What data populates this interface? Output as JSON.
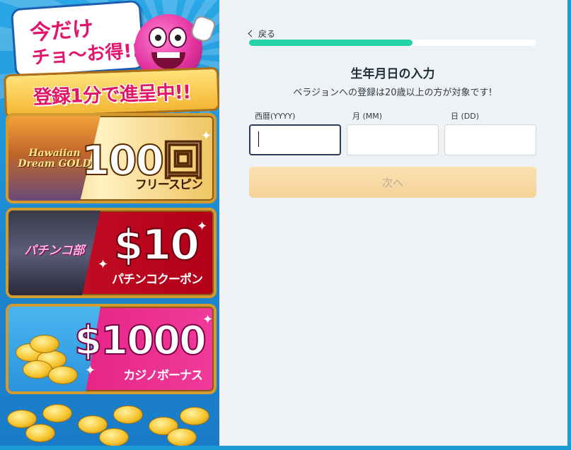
{
  "promo": {
    "bubble_line1": "今だけ",
    "bubble_line2": "チョ〜お得!!",
    "registration_banner": "登録1分で進呈中!!",
    "offers": [
      {
        "game": "Hawaiian Dream GOLD",
        "headline": "100回",
        "sub": "フリースピン"
      },
      {
        "game": "パチンコ部",
        "headline": "$10",
        "sub": "パチンコクーポン"
      },
      {
        "game": "",
        "headline": "$1000",
        "sub": "カジノボーナス"
      }
    ]
  },
  "form": {
    "back_label": "戻る",
    "progress": 0.57,
    "title": "生年月日の入力",
    "subtitle": "ベラジョンへの登録は20歳以上の方が対象です!",
    "fields": [
      {
        "label": "西暦(YYYY)",
        "value": ""
      },
      {
        "label": "月 (MM)",
        "value": ""
      },
      {
        "label": "日 (DD)",
        "value": ""
      }
    ],
    "next_label": "次へ"
  },
  "colors": {
    "progress_fill": "#23d3a7",
    "frame": "#1e9bd7",
    "next_button": "#f6d39a"
  }
}
